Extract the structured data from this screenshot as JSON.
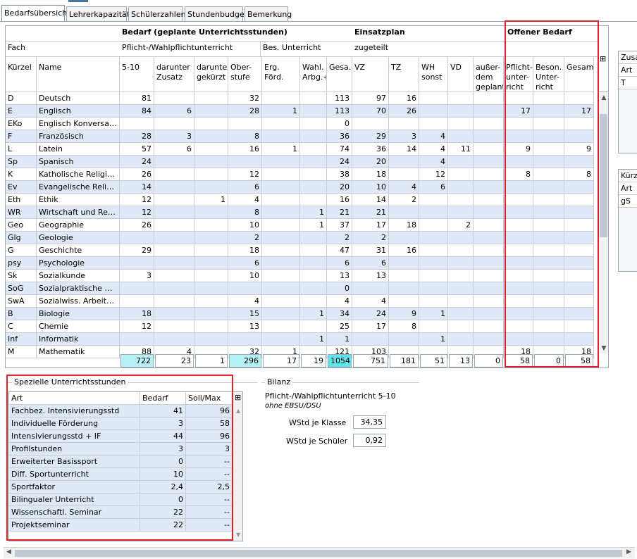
{
  "tabs": [
    "Bedarfsübersicht",
    "Lehrerkapazität",
    "Schülerzahlen",
    "Stundenbudget",
    "Bemerkung"
  ],
  "grid": {
    "group_headers": {
      "bedarf": "Bedarf (geplante Unterrichtsstunden)",
      "einsatz": "Einsatzplan",
      "offen": "Offener Bedarf"
    },
    "sub_headers": {
      "fach": "Fach",
      "pflicht": "Pflicht-/Wahlpflichtunterricht",
      "bes": "Bes. Unterricht",
      "zugeteilt": "zugeteilt"
    },
    "col_headers": [
      "Kürzel",
      "Name",
      "5-10",
      "darunter Zusatz",
      "darunter gekürzt",
      "Ober-stufe",
      "Erg. Förd.",
      "Wahl. Arbg.+",
      "Gesa...",
      "VZ",
      "TZ",
      "WH sonst",
      "VD",
      "außer-dem geplant",
      "Pflicht-unter-richt",
      "Beson. Unter-richt",
      "Gesam..."
    ],
    "rows": [
      [
        "D",
        "Deutsch",
        "81",
        "",
        "",
        "32",
        "",
        "",
        "113",
        "97",
        "16",
        "",
        "",
        "",
        "",
        "",
        ""
      ],
      [
        "E",
        "Englisch",
        "84",
        "6",
        "",
        "28",
        "1",
        "",
        "113",
        "70",
        "26",
        "",
        "",
        "",
        "17",
        "",
        "17"
      ],
      [
        "EKo",
        "Englisch Konversation",
        "",
        "",
        "",
        "",
        "",
        "",
        "0",
        "",
        "",
        "",
        "",
        "",
        "",
        "",
        ""
      ],
      [
        "F",
        "Französisch",
        "28",
        "3",
        "",
        "8",
        "",
        "",
        "36",
        "29",
        "3",
        "4",
        "",
        "",
        "",
        "",
        ""
      ],
      [
        "L",
        "Latein",
        "57",
        "6",
        "",
        "16",
        "1",
        "",
        "74",
        "36",
        "14",
        "4",
        "11",
        "",
        "9",
        "",
        "9"
      ],
      [
        "Sp",
        "Spanisch",
        "24",
        "",
        "",
        "",
        "",
        "",
        "24",
        "20",
        "",
        "4",
        "",
        "",
        "",
        "",
        ""
      ],
      [
        "K",
        "Katholische Religions...",
        "26",
        "",
        "",
        "12",
        "",
        "",
        "38",
        "18",
        "",
        "12",
        "",
        "",
        "8",
        "",
        "8"
      ],
      [
        "Ev",
        "Evangelische Religion...",
        "14",
        "",
        "",
        "6",
        "",
        "",
        "20",
        "10",
        "4",
        "6",
        "",
        "",
        "",
        "",
        ""
      ],
      [
        "Eth",
        "Ethik",
        "12",
        "",
        "1",
        "4",
        "",
        "",
        "16",
        "14",
        "2",
        "",
        "",
        "",
        "",
        "",
        ""
      ],
      [
        "WR",
        "Wirtschaft und Recht",
        "12",
        "",
        "",
        "8",
        "",
        "1",
        "21",
        "21",
        "",
        "",
        "",
        "",
        "",
        "",
        ""
      ],
      [
        "Geo",
        "Geographie",
        "26",
        "",
        "",
        "10",
        "",
        "1",
        "37",
        "17",
        "18",
        "",
        "2",
        "",
        "",
        "",
        ""
      ],
      [
        "Glg",
        "Geologie",
        "",
        "",
        "",
        "2",
        "",
        "",
        "2",
        "2",
        "",
        "",
        "",
        "",
        "",
        "",
        ""
      ],
      [
        "G",
        "Geschichte",
        "29",
        "",
        "",
        "18",
        "",
        "",
        "47",
        "31",
        "16",
        "",
        "",
        "",
        "",
        "",
        ""
      ],
      [
        "psy",
        "Psychologie",
        "",
        "",
        "",
        "6",
        "",
        "",
        "6",
        "6",
        "",
        "",
        "",
        "",
        "",
        "",
        ""
      ],
      [
        "Sk",
        "Sozialkunde",
        "3",
        "",
        "",
        "10",
        "",
        "",
        "13",
        "13",
        "",
        "",
        "",
        "",
        "",
        "",
        ""
      ],
      [
        "SoG",
        "Sozialpraktische Grun...",
        "",
        "",
        "",
        "",
        "",
        "",
        "0",
        "",
        "",
        "",
        "",
        "",
        "",
        "",
        ""
      ],
      [
        "SwA",
        "Sozialwiss. Arbeitsfel...",
        "",
        "",
        "",
        "4",
        "",
        "",
        "4",
        "4",
        "",
        "",
        "",
        "",
        "",
        "",
        ""
      ],
      [
        "B",
        "Biologie",
        "18",
        "",
        "",
        "15",
        "",
        "1",
        "34",
        "24",
        "9",
        "1",
        "",
        "",
        "",
        "",
        ""
      ],
      [
        "C",
        "Chemie",
        "12",
        "",
        "",
        "13",
        "",
        "",
        "25",
        "17",
        "8",
        "",
        "",
        "",
        "",
        "",
        ""
      ],
      [
        "Inf",
        "Informatik",
        "",
        "",
        "",
        "",
        "",
        "1",
        "1",
        "",
        "",
        "1",
        "",
        "",
        "",
        "",
        ""
      ],
      [
        "M",
        "Mathematik",
        "88",
        "4",
        "",
        "32",
        "1",
        "",
        "121",
        "103",
        "",
        "",
        "",
        "",
        "18",
        "",
        "18"
      ]
    ],
    "totals": [
      "722",
      "23",
      "1",
      "296",
      "17",
      "19",
      "1054",
      "751",
      "181",
      "51",
      "13",
      "0",
      "58",
      "0",
      "58"
    ]
  },
  "side_panels": {
    "top": {
      "head": "Zusa",
      "rows": [
        "Art",
        "T"
      ]
    },
    "bottom": {
      "head": "Kürz",
      "rows": [
        "Art",
        "gS"
      ]
    }
  },
  "special": {
    "title": "Spezielle Unterrichtsstunden",
    "headers": [
      "Art",
      "Bedarf",
      "Soll/Max"
    ],
    "rows": [
      [
        "Fachbez. Intensivierungsstd",
        "41",
        "96"
      ],
      [
        "Individuelle Förderung",
        "3",
        "58"
      ],
      [
        "Intensivierungsstd + IF",
        "44",
        "96"
      ],
      [
        "Profilstunden",
        "3",
        "3"
      ],
      [
        "Erweiterter Basissport",
        "0",
        "--"
      ],
      [
        "Diff. Sportunterricht",
        "10",
        "--"
      ],
      [
        "Sportfaktor",
        "2,4",
        "2,5"
      ],
      [
        "Bilingualer Unterricht",
        "0",
        "--"
      ],
      [
        "Wissenschaftl. Seminar",
        "22",
        "--"
      ],
      [
        "Projektseminar",
        "22",
        "--"
      ]
    ]
  },
  "bilanz": {
    "title": "Bilanz",
    "subtitle": "Pflicht-/Wahlpflichtunterricht 5-10",
    "note": "ohne EBSU/DSU",
    "klasse_label": "WStd je Klasse",
    "klasse_value": "34,35",
    "schueler_label": "WStd je Schüler",
    "schueler_value": "0,92"
  },
  "colors": {
    "row_alt": "#dfe8f6",
    "highlight": "#b6f2f5",
    "highlight_strong": "#5ee6f0",
    "annotation": "#e0202a"
  }
}
